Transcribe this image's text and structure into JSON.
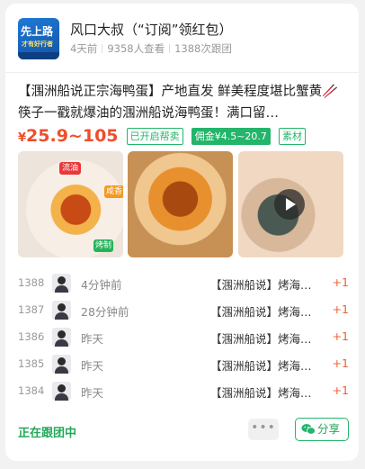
{
  "header": {
    "logo_text_line1": "先上路",
    "logo_text_line2": "才有好行者",
    "title": "风口大叔（“订阅”领红包）",
    "posted": "4天前",
    "views": "9358人查看",
    "follows": "1388次跟团"
  },
  "product": {
    "title": "【涠洲船说正宗海鸭蛋】产地直发 鲜美程度堪比蟹黄🥢筷子一戳就爆油的涠洲船说海鸭蛋！满口留…",
    "currency": "¥",
    "price_range": "25.9~105",
    "tags": [
      "已开启帮卖",
      "佣金¥4.5~20.7",
      "素材"
    ],
    "image_badges": [
      "流油",
      "咸香",
      "烤制"
    ],
    "video_icon": "play-icon"
  },
  "follow_list": [
    {
      "no": "1388",
      "time": "4分钟前",
      "desc": "【涠洲船说】烤海…",
      "qty": "+1"
    },
    {
      "no": "1387",
      "time": "28分钟前",
      "desc": "【涠洲船说】烤海…",
      "qty": "+1"
    },
    {
      "no": "1386",
      "time": "昨天",
      "desc": "【涠洲船说】烤海…",
      "qty": "+1"
    },
    {
      "no": "1385",
      "time": "昨天",
      "desc": "【涠洲船说】烤海…",
      "qty": "+1"
    },
    {
      "no": "1384",
      "time": "昨天",
      "desc": "【涠洲船说】烤海…",
      "qty": "+1"
    }
  ],
  "footer": {
    "status": "正在跟团中",
    "more_label": "•••",
    "share_label": "分享"
  },
  "colors": {
    "price": "#f04e2a",
    "accent_green": "#23b56a",
    "plus": "#f06030"
  }
}
